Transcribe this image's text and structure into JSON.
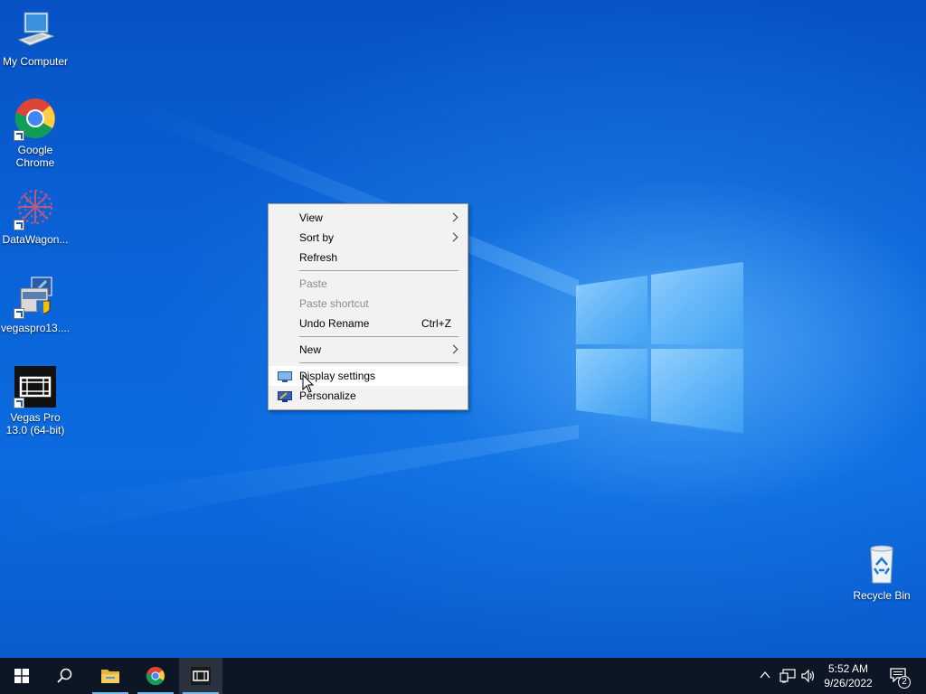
{
  "desktop_icons": [
    {
      "label": "My Computer",
      "icon": "computer-icon"
    },
    {
      "label": "Google Chrome",
      "icon": "chrome-icon"
    },
    {
      "label": "DataWagon...",
      "icon": "datawagon-icon"
    },
    {
      "label": "vegaspro13....",
      "icon": "installer-icon"
    },
    {
      "label": "Vegas Pro 13.0 (64-bit)",
      "icon": "vegas-film-icon"
    },
    {
      "label": "Recycle Bin",
      "icon": "recycle-bin-icon"
    }
  ],
  "context_menu": {
    "items": [
      {
        "label": "View",
        "submenu": true
      },
      {
        "label": "Sort by",
        "submenu": true
      },
      {
        "label": "Refresh"
      },
      {
        "label": "Paste",
        "disabled": true
      },
      {
        "label": "Paste shortcut",
        "disabled": true
      },
      {
        "label": "Undo Rename",
        "shortcut": "Ctrl+Z"
      },
      {
        "label": "New",
        "submenu": true
      },
      {
        "label": "Display settings",
        "icon": "display-icon",
        "hovered": true
      },
      {
        "label": "Personalize",
        "icon": "personalize-icon"
      }
    ]
  },
  "taskbar": {
    "start": "windows-start-icon",
    "search": "search-icon",
    "pinned": [
      {
        "name": "File Explorer",
        "icon": "folder-icon"
      },
      {
        "name": "Google Chrome",
        "icon": "chrome-icon"
      },
      {
        "name": "Vegas Pro",
        "icon": "vegas-film-icon"
      }
    ],
    "tray": {
      "time": "5:52 AM",
      "date": "9/26/2022",
      "notification_count": "2"
    }
  },
  "colors": {
    "taskbar": "#0c1624",
    "menu_bg": "#f2f2f2",
    "accent": "#76b9ed"
  }
}
